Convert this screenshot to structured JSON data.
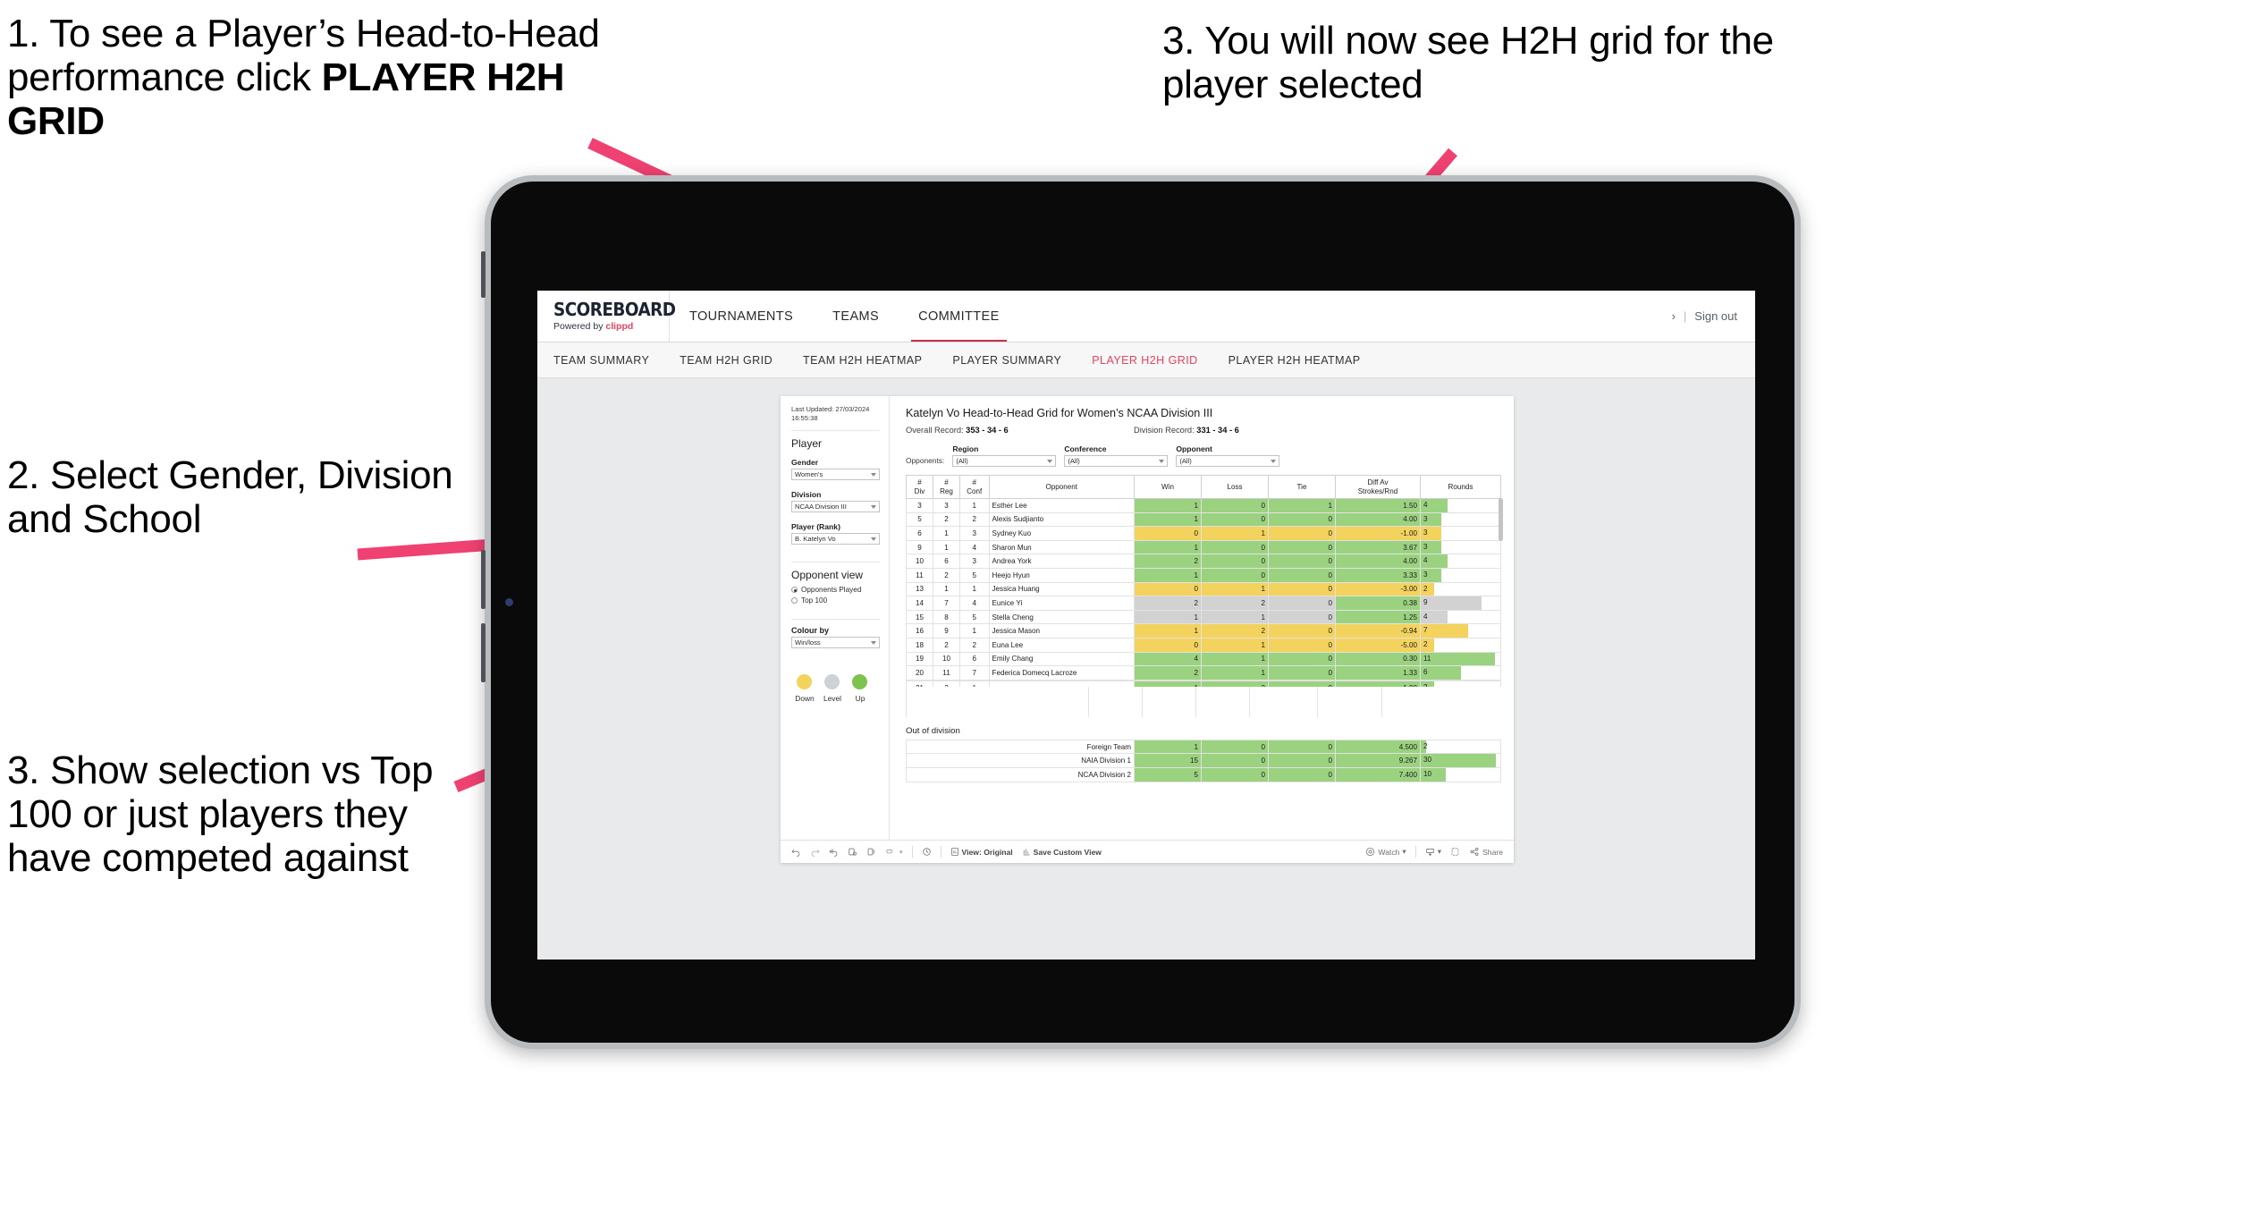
{
  "annotations": [
    {
      "id": "anno-1",
      "text_normal": "1. To see a Player’s Head-to-Head performance click ",
      "text_bold": "PLAYER H2H GRID"
    },
    {
      "id": "anno-2",
      "text": "2. Select Gender, Division and School"
    },
    {
      "id": "anno-3",
      "text": "3. Show selection vs Top 100 or just players they have competed against"
    },
    {
      "id": "anno-4",
      "text": "3. You will now see H2H grid for the player selected"
    }
  ],
  "colors": {
    "accent_pink": "#ef4272",
    "brand_red": "#e8425f",
    "win_green": "#9ad27f",
    "loss_yellow": "#f3d35e",
    "level_grey": "#d2d2d2"
  },
  "site": {
    "logo_main": "SCOREBOARD",
    "logo_sub_prefix": "Powered by ",
    "logo_sub_brand": "clippd",
    "top_nav": [
      {
        "label": "TOURNAMENTS",
        "active": false
      },
      {
        "label": "TEAMS",
        "active": false
      },
      {
        "label": "COMMITTEE",
        "active": true
      }
    ],
    "header_right": {
      "chevron": "›",
      "separator": "|",
      "signout": "Sign out"
    },
    "sub_nav": [
      {
        "label": "TEAM SUMMARY",
        "active": false
      },
      {
        "label": "TEAM H2H GRID",
        "active": false
      },
      {
        "label": "TEAM H2H HEATMAP",
        "active": false
      },
      {
        "label": "PLAYER SUMMARY",
        "active": false
      },
      {
        "label": "PLAYER H2H GRID",
        "active": true
      },
      {
        "label": "PLAYER H2H HEATMAP",
        "active": false
      }
    ]
  },
  "sidebar": {
    "last_updated": "Last Updated: 27/03/2024 16:55:38",
    "player_section_title": "Player",
    "filters": [
      {
        "label": "Gender",
        "value": "Women's"
      },
      {
        "label": "Division",
        "value": "NCAA Division III"
      },
      {
        "label": "Player (Rank)",
        "value": "B. Katelyn Vo"
      }
    ],
    "opponent_view_title": "Opponent view",
    "opponent_view_options": [
      {
        "label": "Opponents Played",
        "selected": true
      },
      {
        "label": "Top 100",
        "selected": false
      }
    ],
    "colour_by_label": "Colour by",
    "colour_by_value": "Win/loss",
    "legend": [
      {
        "label": "Down",
        "color": "#f3d35e"
      },
      {
        "label": "Level",
        "color": "#cfd2d4"
      },
      {
        "label": "Up",
        "color": "#7cc44f"
      }
    ]
  },
  "main": {
    "title": "Katelyn Vo Head-to-Head Grid for Women’s NCAA Division III",
    "overall_record_label": "Overall Record: ",
    "overall_record_value": "353 -  34 - 6",
    "division_record_label": "Division Record: ",
    "division_record_value": "331 -  34 - 6",
    "opponents_label": "Opponents:",
    "opponent_filters": [
      {
        "label": "Region",
        "value": "(All)"
      },
      {
        "label": "Conference",
        "value": "(All)"
      },
      {
        "label": "Opponent",
        "value": "(All)"
      }
    ],
    "out_of_division_title": "Out of division"
  },
  "table": {
    "headers": [
      "#\nDiv",
      "#\nReg",
      "#\nConf",
      "Opponent",
      "Win",
      "Loss",
      "Tie",
      "Diff Av\nStrokes/Rnd",
      "Rounds"
    ],
    "rows": [
      {
        "div": "3",
        "reg": "3",
        "conf": "1",
        "opponent": "Esther Lee",
        "win": "1",
        "loss": "0",
        "tie": "1",
        "diff": "1.50",
        "rounds": "4",
        "state": "g",
        "bar_pct": 34
      },
      {
        "div": "5",
        "reg": "2",
        "conf": "2",
        "opponent": "Alexis Sudjianto",
        "win": "1",
        "loss": "0",
        "tie": "0",
        "diff": "4.00",
        "rounds": "3",
        "state": "g",
        "bar_pct": 26
      },
      {
        "div": "6",
        "reg": "1",
        "conf": "3",
        "opponent": "Sydney Kuo",
        "win": "0",
        "loss": "1",
        "tie": "0",
        "diff": "-1.00",
        "rounds": "3",
        "state": "y",
        "bar_pct": 26
      },
      {
        "div": "9",
        "reg": "1",
        "conf": "4",
        "opponent": "Sharon Mun",
        "win": "1",
        "loss": "0",
        "tie": "0",
        "diff": "3.67",
        "rounds": "3",
        "state": "g",
        "bar_pct": 26
      },
      {
        "div": "10",
        "reg": "6",
        "conf": "3",
        "opponent": "Andrea York",
        "win": "2",
        "loss": "0",
        "tie": "0",
        "diff": "4.00",
        "rounds": "4",
        "state": "g",
        "bar_pct": 34
      },
      {
        "div": "11",
        "reg": "2",
        "conf": "5",
        "opponent": "Heejo Hyun",
        "win": "1",
        "loss": "0",
        "tie": "0",
        "diff": "3.33",
        "rounds": "3",
        "state": "g",
        "bar_pct": 26
      },
      {
        "div": "13",
        "reg": "1",
        "conf": "1",
        "opponent": "Jessica Huang",
        "win": "0",
        "loss": "1",
        "tie": "0",
        "diff": "-3.00",
        "rounds": "2",
        "state": "y",
        "bar_pct": 17
      },
      {
        "div": "14",
        "reg": "7",
        "conf": "4",
        "opponent": "Eunice Yi",
        "win": "2",
        "loss": "2",
        "tie": "0",
        "diff": "0.38",
        "rounds": "9",
        "state": "gr",
        "bar_pct": 76,
        "diff_state": "g"
      },
      {
        "div": "15",
        "reg": "8",
        "conf": "5",
        "opponent": "Stella Cheng",
        "win": "1",
        "loss": "1",
        "tie": "0",
        "diff": "1.25",
        "rounds": "4",
        "state": "gr",
        "bar_pct": 34,
        "diff_state": "g"
      },
      {
        "div": "16",
        "reg": "9",
        "conf": "1",
        "opponent": "Jessica Mason",
        "win": "1",
        "loss": "2",
        "tie": "0",
        "diff": "-0.94",
        "rounds": "7",
        "state": "y",
        "bar_pct": 59
      },
      {
        "div": "18",
        "reg": "2",
        "conf": "2",
        "opponent": "Euna Lee",
        "win": "0",
        "loss": "1",
        "tie": "0",
        "diff": "-5.00",
        "rounds": "2",
        "state": "y",
        "bar_pct": 17
      },
      {
        "div": "19",
        "reg": "10",
        "conf": "6",
        "opponent": "Emily Chang",
        "win": "4",
        "loss": "1",
        "tie": "0",
        "diff": "0.30",
        "rounds": "11",
        "state": "g",
        "bar_pct": 93
      },
      {
        "div": "20",
        "reg": "11",
        "conf": "7",
        "opponent": "Federica Domecq Lacroze",
        "win": "2",
        "loss": "1",
        "tie": "0",
        "diff": "1.33",
        "rounds": "6",
        "state": "g",
        "bar_pct": 51
      }
    ]
  },
  "out_of_division": {
    "rows": [
      {
        "label": "Foreign Team",
        "win": "1",
        "loss": "0",
        "tie": "0",
        "diff": "4.500",
        "rounds": "2",
        "state": "g",
        "bar_pct": 7
      },
      {
        "label": "NAIA Division 1",
        "win": "15",
        "loss": "0",
        "tie": "0",
        "diff": "9.267",
        "rounds": "30",
        "state": "g",
        "bar_pct": 94
      },
      {
        "label": "NCAA Division 2",
        "win": "5",
        "loss": "0",
        "tie": "0",
        "diff": "7.400",
        "rounds": "10",
        "state": "g",
        "bar_pct": 32
      }
    ]
  },
  "toolbar": {
    "view_label": "View: Original",
    "save_label": "Save Custom View",
    "watch_label": "Watch",
    "share_label": "Share",
    "caret": "▾"
  }
}
